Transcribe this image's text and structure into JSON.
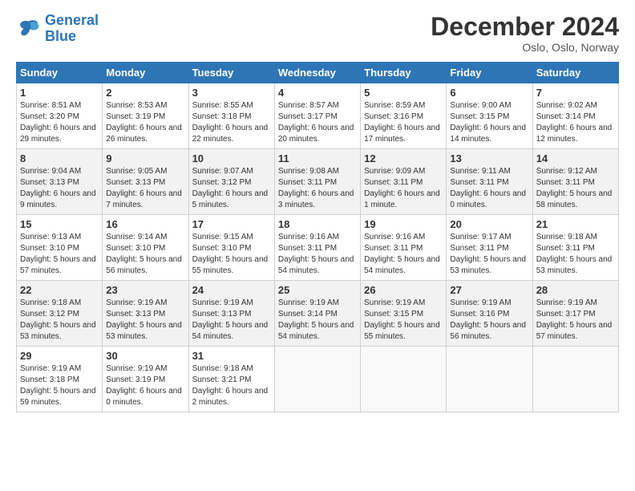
{
  "logo": {
    "line1": "General",
    "line2": "Blue"
  },
  "title": "December 2024",
  "location": "Oslo, Oslo, Norway",
  "headers": [
    "Sunday",
    "Monday",
    "Tuesday",
    "Wednesday",
    "Thursday",
    "Friday",
    "Saturday"
  ],
  "weeks": [
    [
      {
        "day": "1",
        "sunrise": "Sunrise: 8:51 AM",
        "sunset": "Sunset: 3:20 PM",
        "daylight": "Daylight: 6 hours and 29 minutes."
      },
      {
        "day": "2",
        "sunrise": "Sunrise: 8:53 AM",
        "sunset": "Sunset: 3:19 PM",
        "daylight": "Daylight: 6 hours and 26 minutes."
      },
      {
        "day": "3",
        "sunrise": "Sunrise: 8:55 AM",
        "sunset": "Sunset: 3:18 PM",
        "daylight": "Daylight: 6 hours and 22 minutes."
      },
      {
        "day": "4",
        "sunrise": "Sunrise: 8:57 AM",
        "sunset": "Sunset: 3:17 PM",
        "daylight": "Daylight: 6 hours and 20 minutes."
      },
      {
        "day": "5",
        "sunrise": "Sunrise: 8:59 AM",
        "sunset": "Sunset: 3:16 PM",
        "daylight": "Daylight: 6 hours and 17 minutes."
      },
      {
        "day": "6",
        "sunrise": "Sunrise: 9:00 AM",
        "sunset": "Sunset: 3:15 PM",
        "daylight": "Daylight: 6 hours and 14 minutes."
      },
      {
        "day": "7",
        "sunrise": "Sunrise: 9:02 AM",
        "sunset": "Sunset: 3:14 PM",
        "daylight": "Daylight: 6 hours and 12 minutes."
      }
    ],
    [
      {
        "day": "8",
        "sunrise": "Sunrise: 9:04 AM",
        "sunset": "Sunset: 3:13 PM",
        "daylight": "Daylight: 6 hours and 9 minutes."
      },
      {
        "day": "9",
        "sunrise": "Sunrise: 9:05 AM",
        "sunset": "Sunset: 3:13 PM",
        "daylight": "Daylight: 6 hours and 7 minutes."
      },
      {
        "day": "10",
        "sunrise": "Sunrise: 9:07 AM",
        "sunset": "Sunset: 3:12 PM",
        "daylight": "Daylight: 6 hours and 5 minutes."
      },
      {
        "day": "11",
        "sunrise": "Sunrise: 9:08 AM",
        "sunset": "Sunset: 3:11 PM",
        "daylight": "Daylight: 6 hours and 3 minutes."
      },
      {
        "day": "12",
        "sunrise": "Sunrise: 9:09 AM",
        "sunset": "Sunset: 3:11 PM",
        "daylight": "Daylight: 6 hours and 1 minute."
      },
      {
        "day": "13",
        "sunrise": "Sunrise: 9:11 AM",
        "sunset": "Sunset: 3:11 PM",
        "daylight": "Daylight: 6 hours and 0 minutes."
      },
      {
        "day": "14",
        "sunrise": "Sunrise: 9:12 AM",
        "sunset": "Sunset: 3:11 PM",
        "daylight": "Daylight: 5 hours and 58 minutes."
      }
    ],
    [
      {
        "day": "15",
        "sunrise": "Sunrise: 9:13 AM",
        "sunset": "Sunset: 3:10 PM",
        "daylight": "Daylight: 5 hours and 57 minutes."
      },
      {
        "day": "16",
        "sunrise": "Sunrise: 9:14 AM",
        "sunset": "Sunset: 3:10 PM",
        "daylight": "Daylight: 5 hours and 56 minutes."
      },
      {
        "day": "17",
        "sunrise": "Sunrise: 9:15 AM",
        "sunset": "Sunset: 3:10 PM",
        "daylight": "Daylight: 5 hours and 55 minutes."
      },
      {
        "day": "18",
        "sunrise": "Sunrise: 9:16 AM",
        "sunset": "Sunset: 3:11 PM",
        "daylight": "Daylight: 5 hours and 54 minutes."
      },
      {
        "day": "19",
        "sunrise": "Sunrise: 9:16 AM",
        "sunset": "Sunset: 3:11 PM",
        "daylight": "Daylight: 5 hours and 54 minutes."
      },
      {
        "day": "20",
        "sunrise": "Sunrise: 9:17 AM",
        "sunset": "Sunset: 3:11 PM",
        "daylight": "Daylight: 5 hours and 53 minutes."
      },
      {
        "day": "21",
        "sunrise": "Sunrise: 9:18 AM",
        "sunset": "Sunset: 3:11 PM",
        "daylight": "Daylight: 5 hours and 53 minutes."
      }
    ],
    [
      {
        "day": "22",
        "sunrise": "Sunrise: 9:18 AM",
        "sunset": "Sunset: 3:12 PM",
        "daylight": "Daylight: 5 hours and 53 minutes."
      },
      {
        "day": "23",
        "sunrise": "Sunrise: 9:19 AM",
        "sunset": "Sunset: 3:13 PM",
        "daylight": "Daylight: 5 hours and 53 minutes."
      },
      {
        "day": "24",
        "sunrise": "Sunrise: 9:19 AM",
        "sunset": "Sunset: 3:13 PM",
        "daylight": "Daylight: 5 hours and 54 minutes."
      },
      {
        "day": "25",
        "sunrise": "Sunrise: 9:19 AM",
        "sunset": "Sunset: 3:14 PM",
        "daylight": "Daylight: 5 hours and 54 minutes."
      },
      {
        "day": "26",
        "sunrise": "Sunrise: 9:19 AM",
        "sunset": "Sunset: 3:15 PM",
        "daylight": "Daylight: 5 hours and 55 minutes."
      },
      {
        "day": "27",
        "sunrise": "Sunrise: 9:19 AM",
        "sunset": "Sunset: 3:16 PM",
        "daylight": "Daylight: 5 hours and 56 minutes."
      },
      {
        "day": "28",
        "sunrise": "Sunrise: 9:19 AM",
        "sunset": "Sunset: 3:17 PM",
        "daylight": "Daylight: 5 hours and 57 minutes."
      }
    ],
    [
      {
        "day": "29",
        "sunrise": "Sunrise: 9:19 AM",
        "sunset": "Sunset: 3:18 PM",
        "daylight": "Daylight: 5 hours and 59 minutes."
      },
      {
        "day": "30",
        "sunrise": "Sunrise: 9:19 AM",
        "sunset": "Sunset: 3:19 PM",
        "daylight": "Daylight: 6 hours and 0 minutes."
      },
      {
        "day": "31",
        "sunrise": "Sunrise: 9:18 AM",
        "sunset": "Sunset: 3:21 PM",
        "daylight": "Daylight: 6 hours and 2 minutes."
      },
      null,
      null,
      null,
      null
    ]
  ]
}
